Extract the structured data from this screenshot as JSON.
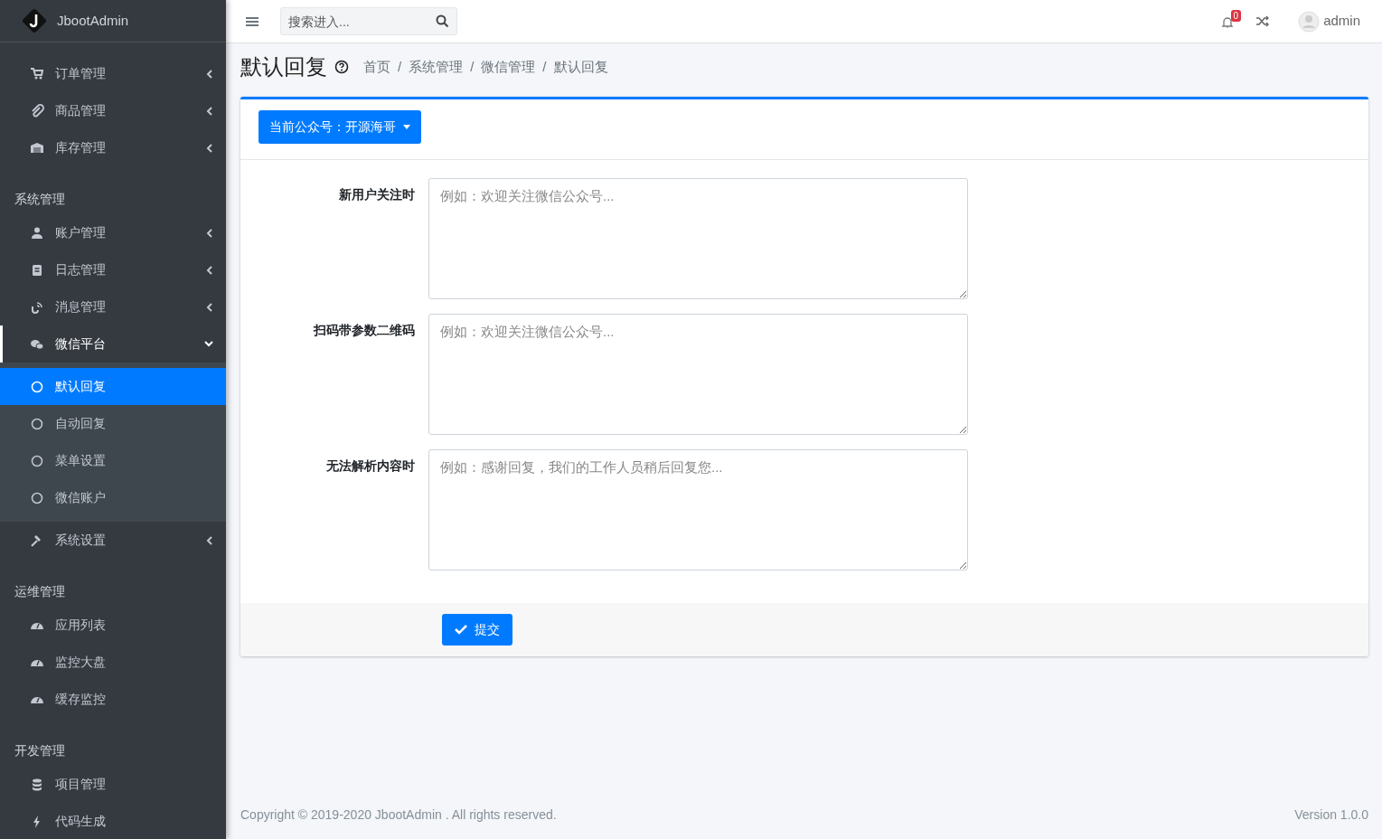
{
  "sidebar": {
    "brand": "JbootAdmin",
    "sections": [
      {
        "items": [
          {
            "label": "订单管理",
            "expanded": false
          },
          {
            "label": "商品管理",
            "expanded": false
          },
          {
            "label": "库存管理",
            "expanded": false
          }
        ]
      },
      {
        "title": "系统管理",
        "items": [
          {
            "label": "账户管理",
            "expanded": false
          },
          {
            "label": "日志管理",
            "expanded": false
          },
          {
            "label": "消息管理",
            "expanded": false
          },
          {
            "label": "微信平台",
            "expanded": true,
            "children": [
              {
                "label": "默认回复",
                "selected": true
              },
              {
                "label": "自动回复",
                "selected": false
              },
              {
                "label": "菜单设置",
                "selected": false
              },
              {
                "label": "微信账户",
                "selected": false
              }
            ]
          },
          {
            "label": "系统设置",
            "expanded": false
          }
        ]
      },
      {
        "title": "运维管理",
        "items": [
          {
            "label": "应用列表"
          },
          {
            "label": "监控大盘"
          },
          {
            "label": "缓存监控"
          }
        ]
      },
      {
        "title": "开发管理",
        "items": [
          {
            "label": "项目管理"
          },
          {
            "label": "代码生成"
          }
        ]
      }
    ]
  },
  "topbar": {
    "search": {
      "placeholder": "搜索进入..."
    },
    "notifications": "0",
    "user": "admin"
  },
  "page": {
    "title": "默认回复",
    "breadcrumb": [
      {
        "label": "首页"
      },
      {
        "separator": "/",
        "label": "系统管理"
      },
      {
        "separator": "/",
        "label": "微信管理"
      },
      {
        "separator": "/",
        "label": "默认回复"
      }
    ]
  },
  "card": {
    "account_button": "当前公众号：开源海哥",
    "fields": [
      {
        "label": "新用户关注时",
        "placeholder": "例如：欢迎关注微信公众号..."
      },
      {
        "label": "扫码带参数二维码",
        "placeholder": "例如：欢迎关注微信公众号..."
      },
      {
        "label": "无法解析内容时",
        "placeholder": "例如：感谢回复，我们的工作人员稍后回复您..."
      }
    ],
    "submit": "提交"
  },
  "footer": {
    "copyright": "Copyright © 2019-2020 JbootAdmin . All rights reserved.",
    "version": "Version 1.0.0"
  }
}
